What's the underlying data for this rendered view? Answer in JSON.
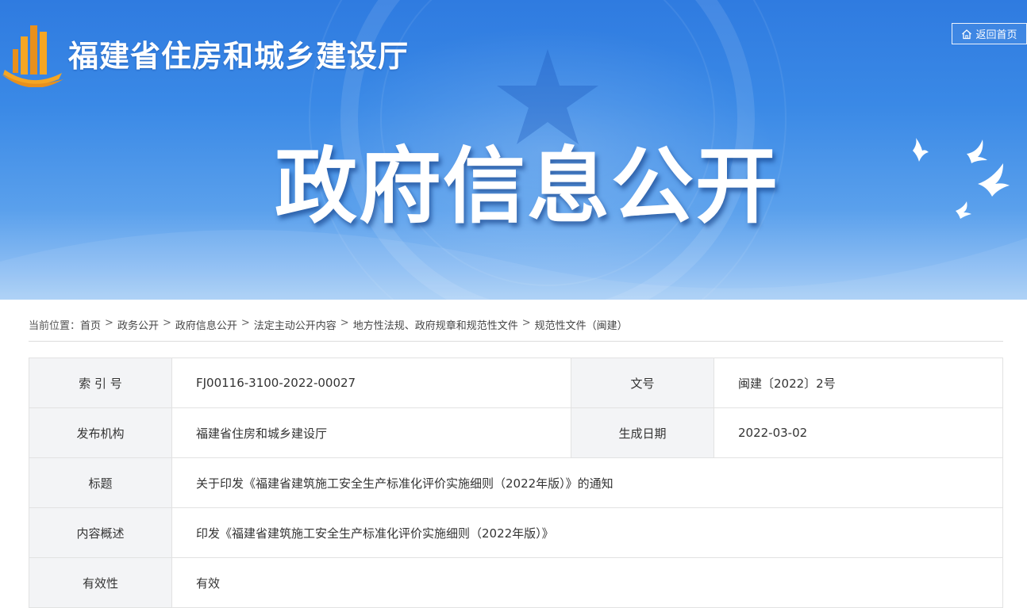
{
  "header": {
    "site_name": "福建省住房和城乡建设厅",
    "home_label": "返回首页",
    "banner_title": "政府信息公开"
  },
  "breadcrumb": {
    "prefix": "当前位置：",
    "items": [
      "首页",
      "政务公开",
      "政府信息公开",
      "法定主动公开内容",
      "地方性法规、政府规章和规范性文件",
      "规范性文件（闽建）"
    ],
    "separator": ">"
  },
  "info": {
    "index_label": "索 引 号",
    "index_value": "FJ00116-3100-2022-00027",
    "docno_label": "文号",
    "docno_value": "闽建〔2022〕2号",
    "issuer_label": "发布机构",
    "issuer_value": "福建省住房和城乡建设厅",
    "date_label": "生成日期",
    "date_value": "2022-03-02",
    "title_label": "标题",
    "title_value": "关于印发《福建省建筑施工安全生产标准化评价实施细则（2022年版）》的通知",
    "summary_label": "内容概述",
    "summary_value": "印发《福建省建筑施工安全生产标准化评价实施细则（2022年版）》",
    "validity_label": "有效性",
    "validity_value": "有效"
  },
  "colors": {
    "banner_top": "#2f7be0",
    "banner_bottom": "#a9cff6",
    "logo_orange": "#e8901c",
    "label_bg": "#f3f4f6",
    "border": "#e2e2e2"
  }
}
